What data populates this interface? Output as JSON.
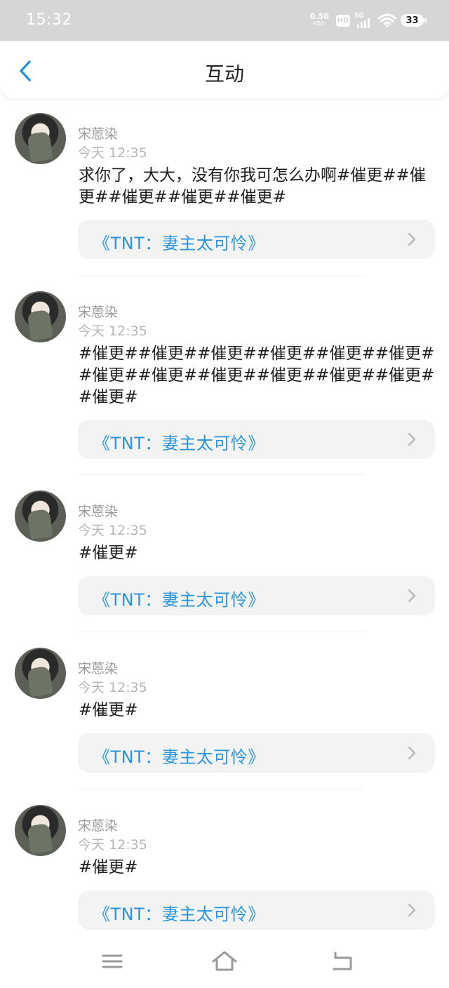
{
  "status_bar": {
    "time": "15:32",
    "net_speed_value": "0.50",
    "net_speed_unit": "KB/s",
    "hd_label": "HD",
    "network_label": "5G",
    "battery_level": "33"
  },
  "header": {
    "title": "互动",
    "back_icon": "chevron-left-icon"
  },
  "colors": {
    "accent": "#2a95de",
    "status_bar_bg": "#d6d6d6",
    "link_card_bg": "#f3f3f3"
  },
  "posts": [
    {
      "username": "宋蒽染",
      "time": "今天 12:35",
      "message": "求你了，大大，没有你我可怎么办啊#催更##催更##催更##催更##催更#",
      "book": "《TNT：妻主太可怜》"
    },
    {
      "username": "宋蒽染",
      "time": "今天 12:35",
      "message": "#催更##催更##催更##催更##催更##催更##催更##催更##催更##催更##催更##催更##催更#",
      "book": "《TNT：妻主太可怜》"
    },
    {
      "username": "宋蒽染",
      "time": "今天 12:35",
      "message": "#催更#",
      "book": "《TNT：妻主太可怜》"
    },
    {
      "username": "宋蒽染",
      "time": "今天 12:35",
      "message": "#催更#",
      "book": "《TNT：妻主太可怜》"
    },
    {
      "username": "宋蒽染",
      "time": "今天 12:35",
      "message": "#催更#",
      "book": "《TNT：妻主太可怜》"
    }
  ],
  "nav_bar": {
    "icons": [
      "menu-icon",
      "home-icon",
      "back-icon"
    ]
  }
}
